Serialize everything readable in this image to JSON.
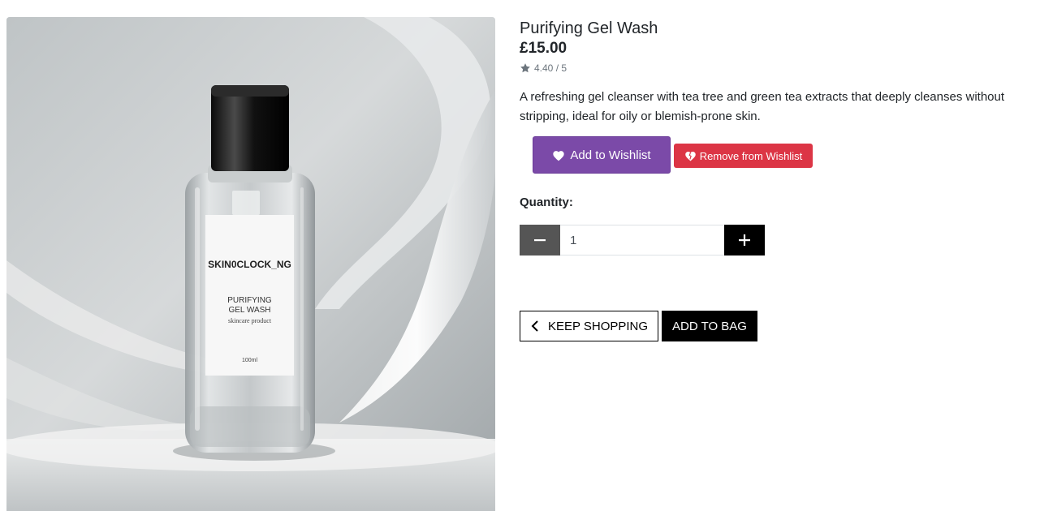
{
  "product": {
    "title": "Purifying Gel Wash",
    "price": "£15.00",
    "rating": "4.40 / 5",
    "description": "A refreshing gel cleanser with tea tree and green tea extracts that deeply cleanses without stripping, ideal for oily or blemish-prone skin.",
    "image": {
      "label_brand": "SKIN0CLOCK_NG",
      "label_line1": "PURIFYING",
      "label_line2": "GEL WASH",
      "label_line3": "skincare product",
      "label_volume": "100ml"
    }
  },
  "wishlist": {
    "add_label": "Add to Wishlist",
    "remove_label": "Remove from Wishlist",
    "add_color": "#7b4aa8",
    "remove_color": "#dc3545"
  },
  "quantity": {
    "label": "Quantity:",
    "value": "1"
  },
  "actions": {
    "keep_shopping_label": "KEEP SHOPPING",
    "add_to_bag_label": "ADD TO BAG"
  },
  "icons": {
    "rating": "star-icon",
    "wishlist_add": "heart-icon",
    "wishlist_remove": "heart-broken-icon",
    "decrease": "minus-icon",
    "increase": "plus-icon",
    "back": "chevron-left-icon"
  }
}
